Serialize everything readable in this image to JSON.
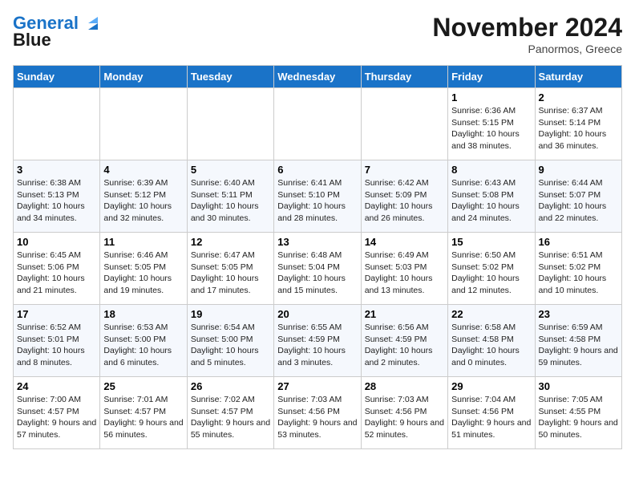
{
  "header": {
    "logo_line1": "General",
    "logo_line2": "Blue",
    "month": "November 2024",
    "location": "Panormos, Greece"
  },
  "columns": [
    "Sunday",
    "Monday",
    "Tuesday",
    "Wednesday",
    "Thursday",
    "Friday",
    "Saturday"
  ],
  "weeks": [
    [
      {
        "day": "",
        "text": ""
      },
      {
        "day": "",
        "text": ""
      },
      {
        "day": "",
        "text": ""
      },
      {
        "day": "",
        "text": ""
      },
      {
        "day": "",
        "text": ""
      },
      {
        "day": "1",
        "text": "Sunrise: 6:36 AM\nSunset: 5:15 PM\nDaylight: 10 hours and 38 minutes."
      },
      {
        "day": "2",
        "text": "Sunrise: 6:37 AM\nSunset: 5:14 PM\nDaylight: 10 hours and 36 minutes."
      }
    ],
    [
      {
        "day": "3",
        "text": "Sunrise: 6:38 AM\nSunset: 5:13 PM\nDaylight: 10 hours and 34 minutes."
      },
      {
        "day": "4",
        "text": "Sunrise: 6:39 AM\nSunset: 5:12 PM\nDaylight: 10 hours and 32 minutes."
      },
      {
        "day": "5",
        "text": "Sunrise: 6:40 AM\nSunset: 5:11 PM\nDaylight: 10 hours and 30 minutes."
      },
      {
        "day": "6",
        "text": "Sunrise: 6:41 AM\nSunset: 5:10 PM\nDaylight: 10 hours and 28 minutes."
      },
      {
        "day": "7",
        "text": "Sunrise: 6:42 AM\nSunset: 5:09 PM\nDaylight: 10 hours and 26 minutes."
      },
      {
        "day": "8",
        "text": "Sunrise: 6:43 AM\nSunset: 5:08 PM\nDaylight: 10 hours and 24 minutes."
      },
      {
        "day": "9",
        "text": "Sunrise: 6:44 AM\nSunset: 5:07 PM\nDaylight: 10 hours and 22 minutes."
      }
    ],
    [
      {
        "day": "10",
        "text": "Sunrise: 6:45 AM\nSunset: 5:06 PM\nDaylight: 10 hours and 21 minutes."
      },
      {
        "day": "11",
        "text": "Sunrise: 6:46 AM\nSunset: 5:05 PM\nDaylight: 10 hours and 19 minutes."
      },
      {
        "day": "12",
        "text": "Sunrise: 6:47 AM\nSunset: 5:05 PM\nDaylight: 10 hours and 17 minutes."
      },
      {
        "day": "13",
        "text": "Sunrise: 6:48 AM\nSunset: 5:04 PM\nDaylight: 10 hours and 15 minutes."
      },
      {
        "day": "14",
        "text": "Sunrise: 6:49 AM\nSunset: 5:03 PM\nDaylight: 10 hours and 13 minutes."
      },
      {
        "day": "15",
        "text": "Sunrise: 6:50 AM\nSunset: 5:02 PM\nDaylight: 10 hours and 12 minutes."
      },
      {
        "day": "16",
        "text": "Sunrise: 6:51 AM\nSunset: 5:02 PM\nDaylight: 10 hours and 10 minutes."
      }
    ],
    [
      {
        "day": "17",
        "text": "Sunrise: 6:52 AM\nSunset: 5:01 PM\nDaylight: 10 hours and 8 minutes."
      },
      {
        "day": "18",
        "text": "Sunrise: 6:53 AM\nSunset: 5:00 PM\nDaylight: 10 hours and 6 minutes."
      },
      {
        "day": "19",
        "text": "Sunrise: 6:54 AM\nSunset: 5:00 PM\nDaylight: 10 hours and 5 minutes."
      },
      {
        "day": "20",
        "text": "Sunrise: 6:55 AM\nSunset: 4:59 PM\nDaylight: 10 hours and 3 minutes."
      },
      {
        "day": "21",
        "text": "Sunrise: 6:56 AM\nSunset: 4:59 PM\nDaylight: 10 hours and 2 minutes."
      },
      {
        "day": "22",
        "text": "Sunrise: 6:58 AM\nSunset: 4:58 PM\nDaylight: 10 hours and 0 minutes."
      },
      {
        "day": "23",
        "text": "Sunrise: 6:59 AM\nSunset: 4:58 PM\nDaylight: 9 hours and 59 minutes."
      }
    ],
    [
      {
        "day": "24",
        "text": "Sunrise: 7:00 AM\nSunset: 4:57 PM\nDaylight: 9 hours and 57 minutes."
      },
      {
        "day": "25",
        "text": "Sunrise: 7:01 AM\nSunset: 4:57 PM\nDaylight: 9 hours and 56 minutes."
      },
      {
        "day": "26",
        "text": "Sunrise: 7:02 AM\nSunset: 4:57 PM\nDaylight: 9 hours and 55 minutes."
      },
      {
        "day": "27",
        "text": "Sunrise: 7:03 AM\nSunset: 4:56 PM\nDaylight: 9 hours and 53 minutes."
      },
      {
        "day": "28",
        "text": "Sunrise: 7:03 AM\nSunset: 4:56 PM\nDaylight: 9 hours and 52 minutes."
      },
      {
        "day": "29",
        "text": "Sunrise: 7:04 AM\nSunset: 4:56 PM\nDaylight: 9 hours and 51 minutes."
      },
      {
        "day": "30",
        "text": "Sunrise: 7:05 AM\nSunset: 4:55 PM\nDaylight: 9 hours and 50 minutes."
      }
    ]
  ]
}
